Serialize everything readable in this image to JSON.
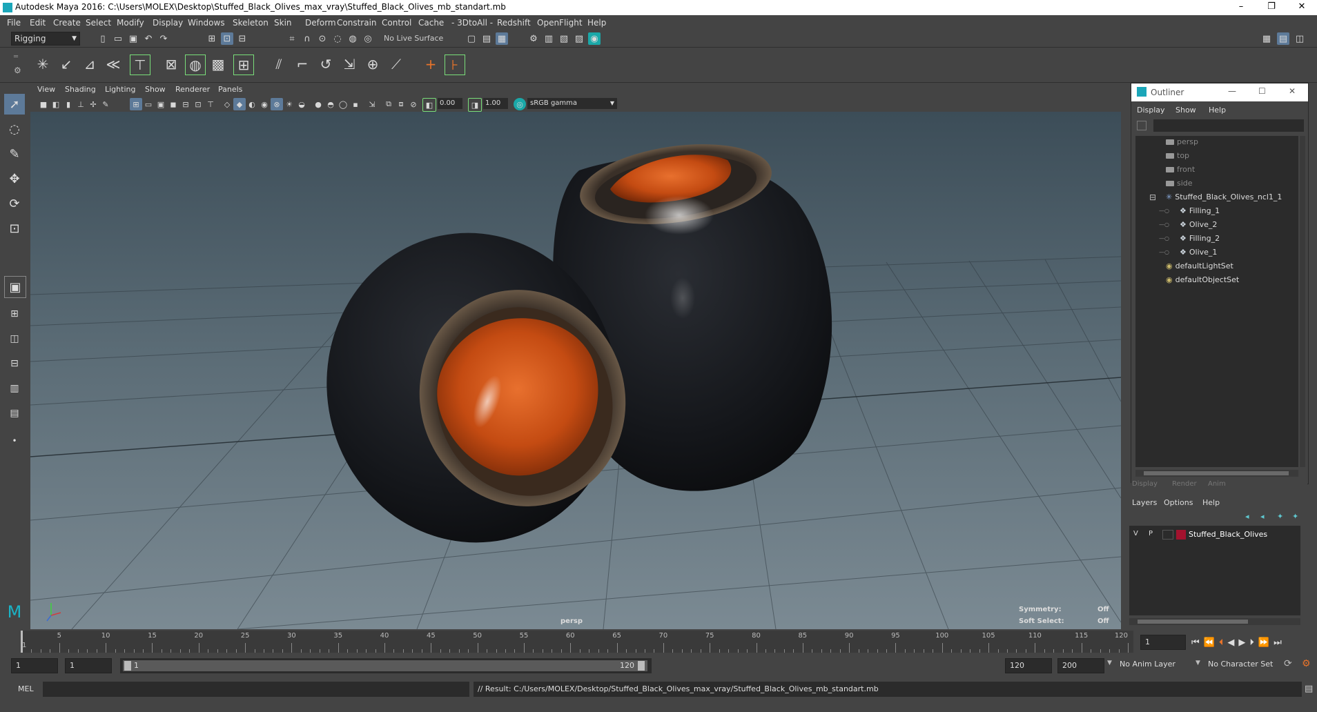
{
  "window": {
    "title": "Autodesk Maya 2016: C:\\Users\\MOLEX\\Desktop\\Stuffed_Black_Olives_max_vray\\Stuffed_Black_Olives_mb_standart.mb",
    "minimize": "–",
    "restore": "❐",
    "close": "✕"
  },
  "menubar": [
    "File",
    "Edit",
    "Create",
    "Select",
    "Modify",
    "Display",
    "Windows",
    "Skeleton",
    "Skin",
    "Deform",
    "Constrain",
    "Control",
    "Cache",
    "- 3DtoAll -",
    "Redshift",
    "OpenFlight",
    "Help"
  ],
  "statusline": {
    "menuset": "Rigging",
    "live_surface": "No Live Surface"
  },
  "viewport": {
    "menus": [
      "View",
      "Shading",
      "Lighting",
      "Show",
      "Renderer",
      "Panels"
    ],
    "near_value": "0.00",
    "far_value": "1.00",
    "color_space": "sRGB gamma",
    "camera_label": "persp",
    "symmetry_label": "Symmetry:",
    "symmetry_value": "Off",
    "soft_select_label": "Soft Select:",
    "soft_select_value": "Off"
  },
  "outliner": {
    "title": "Outliner",
    "menus": [
      "Display",
      "Show",
      "Help"
    ],
    "items": [
      {
        "label": "persp",
        "type": "camera",
        "dim": true
      },
      {
        "label": "top",
        "type": "camera",
        "dim": true
      },
      {
        "label": "front",
        "type": "camera",
        "dim": true
      },
      {
        "label": "side",
        "type": "camera",
        "dim": true
      },
      {
        "label": "Stuffed_Black_Olives_ncl1_1",
        "type": "group",
        "dim": false
      },
      {
        "label": "Filling_1",
        "type": "mesh",
        "dim": false
      },
      {
        "label": "Olive_2",
        "type": "mesh",
        "dim": false
      },
      {
        "label": "Filling_2",
        "type": "mesh",
        "dim": false
      },
      {
        "label": "Olive_1",
        "type": "mesh",
        "dim": false
      },
      {
        "label": "defaultLightSet",
        "type": "set",
        "dim": false
      },
      {
        "label": "defaultObjectSet",
        "type": "set",
        "dim": false
      }
    ]
  },
  "layer_editor": {
    "tabs": [
      "Display",
      "Render",
      "Anim"
    ],
    "menus": [
      "Layers",
      "Options",
      "Help"
    ],
    "layer": {
      "v": "V",
      "p": "P",
      "name": "Stuffed_Black_Olives",
      "color": "#a3122e"
    }
  },
  "timeslider": {
    "ticks": [
      "1",
      "5",
      "10",
      "15",
      "20",
      "25",
      "30",
      "35",
      "40",
      "45",
      "50",
      "55",
      "60",
      "65",
      "70",
      "75",
      "80",
      "85",
      "90",
      "95",
      "100",
      "105",
      "110",
      "115",
      "120"
    ],
    "current_frame": "1"
  },
  "rangeslider": {
    "start": "1",
    "playback_start": "1",
    "range_start_label": "1",
    "range_end_label": "120",
    "playback_end": "120",
    "end": "200",
    "anim_layer": "No Anim Layer",
    "character_set": "No Character Set"
  },
  "commandline": {
    "lang": "MEL",
    "result": "// Result: C:/Users/MOLEX/Desktop/Stuffed_Black_Olives_max_vray/Stuffed_Black_Olives_mb_standart.mb"
  }
}
